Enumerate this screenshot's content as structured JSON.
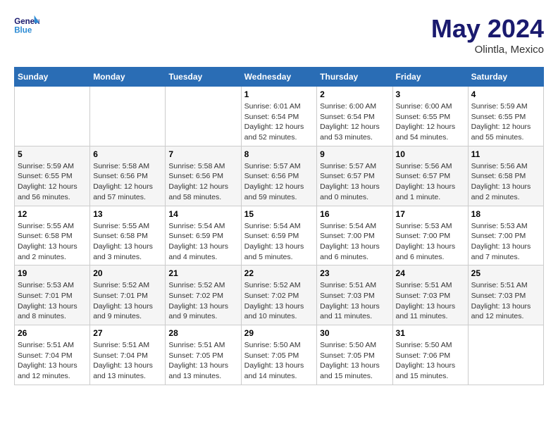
{
  "header": {
    "logo_line1": "General",
    "logo_line2": "Blue",
    "month": "May 2024",
    "location": "Olintla, Mexico"
  },
  "weekdays": [
    "Sunday",
    "Monday",
    "Tuesday",
    "Wednesday",
    "Thursday",
    "Friday",
    "Saturday"
  ],
  "weeks": [
    [
      {
        "day": "",
        "info": ""
      },
      {
        "day": "",
        "info": ""
      },
      {
        "day": "",
        "info": ""
      },
      {
        "day": "1",
        "info": "Sunrise: 6:01 AM\nSunset: 6:54 PM\nDaylight: 12 hours and 52 minutes."
      },
      {
        "day": "2",
        "info": "Sunrise: 6:00 AM\nSunset: 6:54 PM\nDaylight: 12 hours and 53 minutes."
      },
      {
        "day": "3",
        "info": "Sunrise: 6:00 AM\nSunset: 6:55 PM\nDaylight: 12 hours and 54 minutes."
      },
      {
        "day": "4",
        "info": "Sunrise: 5:59 AM\nSunset: 6:55 PM\nDaylight: 12 hours and 55 minutes."
      }
    ],
    [
      {
        "day": "5",
        "info": "Sunrise: 5:59 AM\nSunset: 6:55 PM\nDaylight: 12 hours and 56 minutes."
      },
      {
        "day": "6",
        "info": "Sunrise: 5:58 AM\nSunset: 6:56 PM\nDaylight: 12 hours and 57 minutes."
      },
      {
        "day": "7",
        "info": "Sunrise: 5:58 AM\nSunset: 6:56 PM\nDaylight: 12 hours and 58 minutes."
      },
      {
        "day": "8",
        "info": "Sunrise: 5:57 AM\nSunset: 6:56 PM\nDaylight: 12 hours and 59 minutes."
      },
      {
        "day": "9",
        "info": "Sunrise: 5:57 AM\nSunset: 6:57 PM\nDaylight: 13 hours and 0 minutes."
      },
      {
        "day": "10",
        "info": "Sunrise: 5:56 AM\nSunset: 6:57 PM\nDaylight: 13 hours and 1 minute."
      },
      {
        "day": "11",
        "info": "Sunrise: 5:56 AM\nSunset: 6:58 PM\nDaylight: 13 hours and 2 minutes."
      }
    ],
    [
      {
        "day": "12",
        "info": "Sunrise: 5:55 AM\nSunset: 6:58 PM\nDaylight: 13 hours and 2 minutes."
      },
      {
        "day": "13",
        "info": "Sunrise: 5:55 AM\nSunset: 6:58 PM\nDaylight: 13 hours and 3 minutes."
      },
      {
        "day": "14",
        "info": "Sunrise: 5:54 AM\nSunset: 6:59 PM\nDaylight: 13 hours and 4 minutes."
      },
      {
        "day": "15",
        "info": "Sunrise: 5:54 AM\nSunset: 6:59 PM\nDaylight: 13 hours and 5 minutes."
      },
      {
        "day": "16",
        "info": "Sunrise: 5:54 AM\nSunset: 7:00 PM\nDaylight: 13 hours and 6 minutes."
      },
      {
        "day": "17",
        "info": "Sunrise: 5:53 AM\nSunset: 7:00 PM\nDaylight: 13 hours and 6 minutes."
      },
      {
        "day": "18",
        "info": "Sunrise: 5:53 AM\nSunset: 7:00 PM\nDaylight: 13 hours and 7 minutes."
      }
    ],
    [
      {
        "day": "19",
        "info": "Sunrise: 5:53 AM\nSunset: 7:01 PM\nDaylight: 13 hours and 8 minutes."
      },
      {
        "day": "20",
        "info": "Sunrise: 5:52 AM\nSunset: 7:01 PM\nDaylight: 13 hours and 9 minutes."
      },
      {
        "day": "21",
        "info": "Sunrise: 5:52 AM\nSunset: 7:02 PM\nDaylight: 13 hours and 9 minutes."
      },
      {
        "day": "22",
        "info": "Sunrise: 5:52 AM\nSunset: 7:02 PM\nDaylight: 13 hours and 10 minutes."
      },
      {
        "day": "23",
        "info": "Sunrise: 5:51 AM\nSunset: 7:03 PM\nDaylight: 13 hours and 11 minutes."
      },
      {
        "day": "24",
        "info": "Sunrise: 5:51 AM\nSunset: 7:03 PM\nDaylight: 13 hours and 11 minutes."
      },
      {
        "day": "25",
        "info": "Sunrise: 5:51 AM\nSunset: 7:03 PM\nDaylight: 13 hours and 12 minutes."
      }
    ],
    [
      {
        "day": "26",
        "info": "Sunrise: 5:51 AM\nSunset: 7:04 PM\nDaylight: 13 hours and 12 minutes."
      },
      {
        "day": "27",
        "info": "Sunrise: 5:51 AM\nSunset: 7:04 PM\nDaylight: 13 hours and 13 minutes."
      },
      {
        "day": "28",
        "info": "Sunrise: 5:51 AM\nSunset: 7:05 PM\nDaylight: 13 hours and 13 minutes."
      },
      {
        "day": "29",
        "info": "Sunrise: 5:50 AM\nSunset: 7:05 PM\nDaylight: 13 hours and 14 minutes."
      },
      {
        "day": "30",
        "info": "Sunrise: 5:50 AM\nSunset: 7:05 PM\nDaylight: 13 hours and 15 minutes."
      },
      {
        "day": "31",
        "info": "Sunrise: 5:50 AM\nSunset: 7:06 PM\nDaylight: 13 hours and 15 minutes."
      },
      {
        "day": "",
        "info": ""
      }
    ]
  ]
}
